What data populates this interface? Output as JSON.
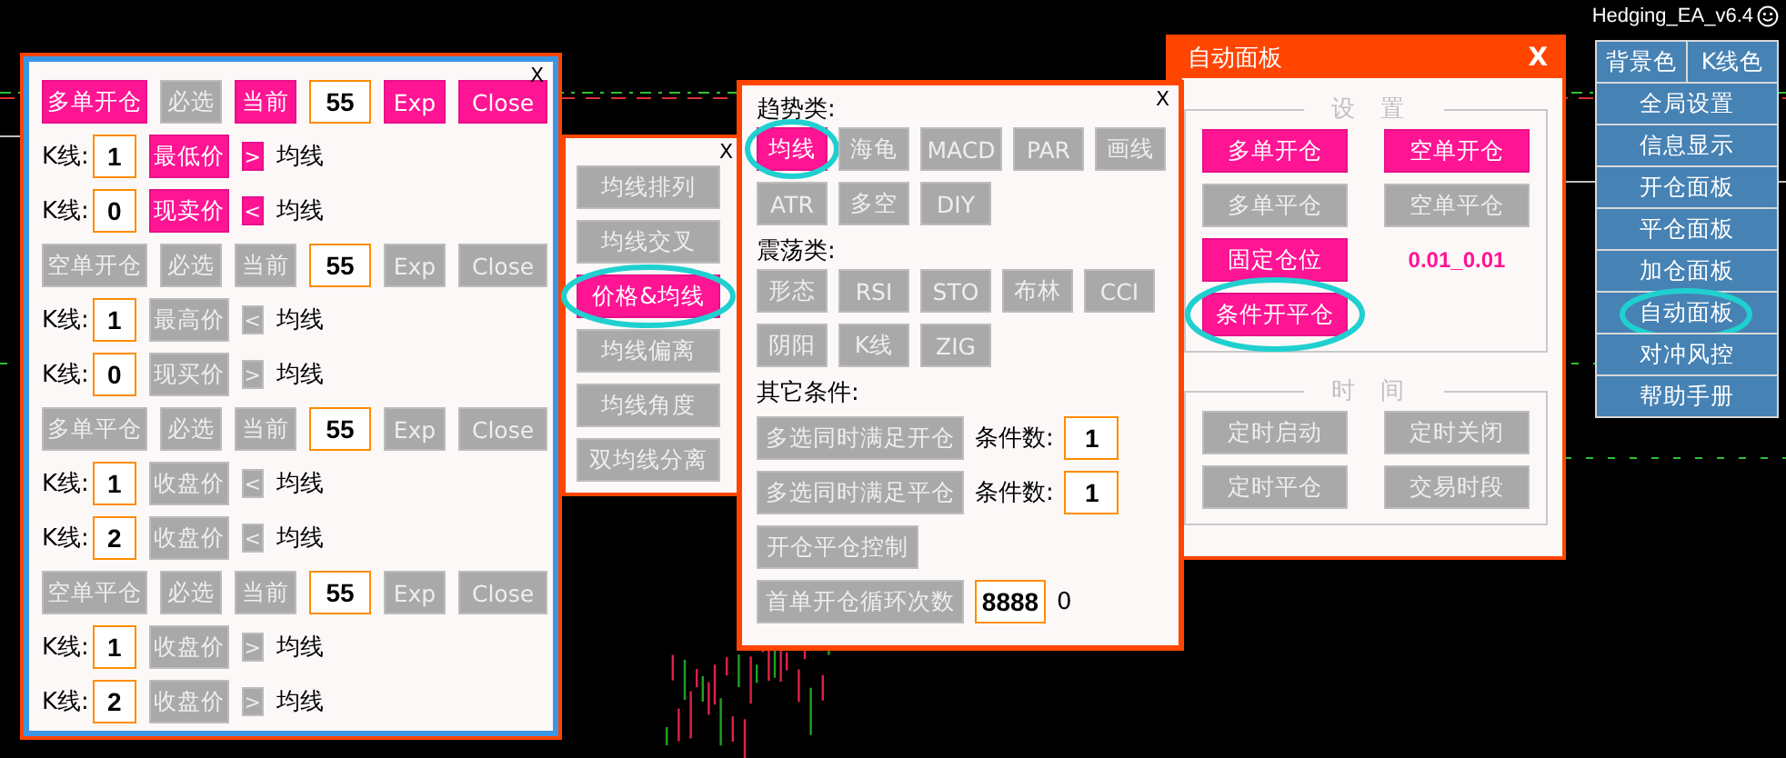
{
  "chart_label": "Hedging_EA_v6.4",
  "order_panel": {
    "close": "X",
    "groups": [
      {
        "head": {
          "order": {
            "label": "多单开仓",
            "on": true
          },
          "required": {
            "label": "必选",
            "on": false
          },
          "current": {
            "label": "当前",
            "on": true
          },
          "value": "55",
          "exp": {
            "label": "Exp",
            "on": true
          },
          "close": {
            "label": "Close",
            "on": true
          }
        },
        "conditions": [
          {
            "k_label": "K线:",
            "k_value": "1",
            "price": {
              "label": "最低价",
              "on": true
            },
            "operator": {
              "label": ">",
              "on": true
            },
            "target": "均线"
          },
          {
            "k_label": "K线:",
            "k_value": "0",
            "price": {
              "label": "现卖价",
              "on": true
            },
            "operator": {
              "label": "<",
              "on": true
            },
            "target": "均线"
          }
        ]
      },
      {
        "head": {
          "order": {
            "label": "空单开仓",
            "on": false
          },
          "required": {
            "label": "必选",
            "on": false
          },
          "current": {
            "label": "当前",
            "on": false
          },
          "value": "55",
          "exp": {
            "label": "Exp",
            "on": false
          },
          "close": {
            "label": "Close",
            "on": false
          }
        },
        "conditions": [
          {
            "k_label": "K线:",
            "k_value": "1",
            "price": {
              "label": "最高价",
              "on": false
            },
            "operator": {
              "label": "<",
              "on": false
            },
            "target": "均线"
          },
          {
            "k_label": "K线:",
            "k_value": "0",
            "price": {
              "label": "现买价",
              "on": false
            },
            "operator": {
              "label": ">",
              "on": false
            },
            "target": "均线"
          }
        ]
      },
      {
        "head": {
          "order": {
            "label": "多单平仓",
            "on": false
          },
          "required": {
            "label": "必选",
            "on": false
          },
          "current": {
            "label": "当前",
            "on": false
          },
          "value": "55",
          "exp": {
            "label": "Exp",
            "on": false
          },
          "close": {
            "label": "Close",
            "on": false
          }
        },
        "conditions": [
          {
            "k_label": "K线:",
            "k_value": "1",
            "price": {
              "label": "收盘价",
              "on": false
            },
            "operator": {
              "label": "<",
              "on": false
            },
            "target": "均线"
          },
          {
            "k_label": "K线:",
            "k_value": "2",
            "price": {
              "label": "收盘价",
              "on": false
            },
            "operator": {
              "label": "<",
              "on": false
            },
            "target": "均线"
          }
        ]
      },
      {
        "head": {
          "order": {
            "label": "空单平仓",
            "on": false
          },
          "required": {
            "label": "必选",
            "on": false
          },
          "current": {
            "label": "当前",
            "on": false
          },
          "value": "55",
          "exp": {
            "label": "Exp",
            "on": false
          },
          "close": {
            "label": "Close",
            "on": false
          }
        },
        "conditions": [
          {
            "k_label": "K线:",
            "k_value": "1",
            "price": {
              "label": "收盘价",
              "on": false
            },
            "operator": {
              "label": ">",
              "on": false
            },
            "target": "均线"
          },
          {
            "k_label": "K线:",
            "k_value": "2",
            "price": {
              "label": "收盘价",
              "on": false
            },
            "operator": {
              "label": ">",
              "on": false
            },
            "target": "均线"
          }
        ]
      }
    ]
  },
  "indicator_menu": {
    "close": "X",
    "items": [
      {
        "label": "均线排列",
        "on": false,
        "highlighted": false
      },
      {
        "label": "均线交叉",
        "on": false,
        "highlighted": false
      },
      {
        "label": "价格&均线",
        "on": true,
        "highlighted": true
      },
      {
        "label": "均线偏离",
        "on": false,
        "highlighted": false
      },
      {
        "label": "均线角度",
        "on": false,
        "highlighted": false
      },
      {
        "label": "双均线分离",
        "on": false,
        "highlighted": false
      }
    ]
  },
  "condition_panel": {
    "close": "X",
    "sections": [
      {
        "title": "趋势类:",
        "items": [
          {
            "label": "均线",
            "on": true,
            "highlighted": true
          },
          {
            "label": "海龟",
            "on": false,
            "highlighted": false
          },
          {
            "label": "MACD",
            "on": false,
            "highlighted": false
          },
          {
            "label": "PAR",
            "on": false,
            "highlighted": false
          },
          {
            "label": "画线",
            "on": false,
            "highlighted": false
          },
          {
            "label": "ATR",
            "on": false,
            "highlighted": false
          },
          {
            "label": "多空",
            "on": false,
            "highlighted": false
          },
          {
            "label": "DIY",
            "on": false,
            "highlighted": false
          }
        ]
      },
      {
        "title": "震荡类:",
        "items": [
          {
            "label": "形态",
            "on": false,
            "highlighted": false
          },
          {
            "label": "RSI",
            "on": false,
            "highlighted": false
          },
          {
            "label": "STO",
            "on": false,
            "highlighted": false
          },
          {
            "label": "布林",
            "on": false,
            "highlighted": false
          },
          {
            "label": "CCI",
            "on": false,
            "highlighted": false
          },
          {
            "label": "阴阳",
            "on": false,
            "highlighted": false
          },
          {
            "label": "K线",
            "on": false,
            "highlighted": false
          },
          {
            "label": "ZIG",
            "on": false,
            "highlighted": false
          }
        ]
      }
    ],
    "other": {
      "title": "其它条件:",
      "rows": [
        {
          "kind": "count",
          "button": {
            "label": "多选同时满足开仓",
            "on": false
          },
          "label": "条件数:",
          "value": "1"
        },
        {
          "kind": "count",
          "button": {
            "label": "多选同时满足平仓",
            "on": false
          },
          "label": "条件数:",
          "value": "1"
        },
        {
          "kind": "button",
          "button": {
            "label": "开仓平仓控制",
            "on": false
          }
        },
        {
          "kind": "loop",
          "button": {
            "label": "首单开仓循环次数",
            "on": false
          },
          "value": "8888",
          "reading": "0"
        }
      ]
    }
  },
  "auto_panel": {
    "title": "自动面板",
    "close": "X",
    "sections": [
      {
        "title": "设置",
        "items": [
          {
            "kind": "button",
            "label": "多单开仓",
            "on": true,
            "highlighted": false
          },
          {
            "kind": "button",
            "label": "空单开仓",
            "on": true,
            "highlighted": false
          },
          {
            "kind": "button",
            "label": "多单平仓",
            "on": false,
            "highlighted": false
          },
          {
            "kind": "button",
            "label": "空单平仓",
            "on": false,
            "highlighted": false
          },
          {
            "kind": "button",
            "label": "固定仓位",
            "on": true,
            "highlighted": false
          },
          {
            "kind": "text",
            "label": "0.01_0.01"
          },
          {
            "kind": "button",
            "label": "条件开平仓",
            "on": true,
            "highlighted": true
          }
        ]
      },
      {
        "title": "时间",
        "items": [
          {
            "kind": "button",
            "label": "定时启动",
            "on": false,
            "highlighted": false
          },
          {
            "kind": "button",
            "label": "定时关闭",
            "on": false,
            "highlighted": false
          },
          {
            "kind": "button",
            "label": "定时平仓",
            "on": false,
            "highlighted": false
          },
          {
            "kind": "button",
            "label": "交易时段",
            "on": false,
            "highlighted": false
          }
        ]
      }
    ]
  },
  "side_menu": {
    "top": [
      {
        "label": "背景色"
      },
      {
        "label": "K线色"
      }
    ],
    "items": [
      {
        "label": "全局设置",
        "highlighted": false
      },
      {
        "label": "信息显示",
        "highlighted": false
      },
      {
        "label": "开仓面板",
        "highlighted": false
      },
      {
        "label": "平仓面板",
        "highlighted": false
      },
      {
        "label": "加仓面板",
        "highlighted": false
      },
      {
        "label": "自动面板",
        "highlighted": true
      },
      {
        "label": "对冲风控",
        "highlighted": false
      },
      {
        "label": "帮助手册",
        "highlighted": false
      }
    ]
  }
}
